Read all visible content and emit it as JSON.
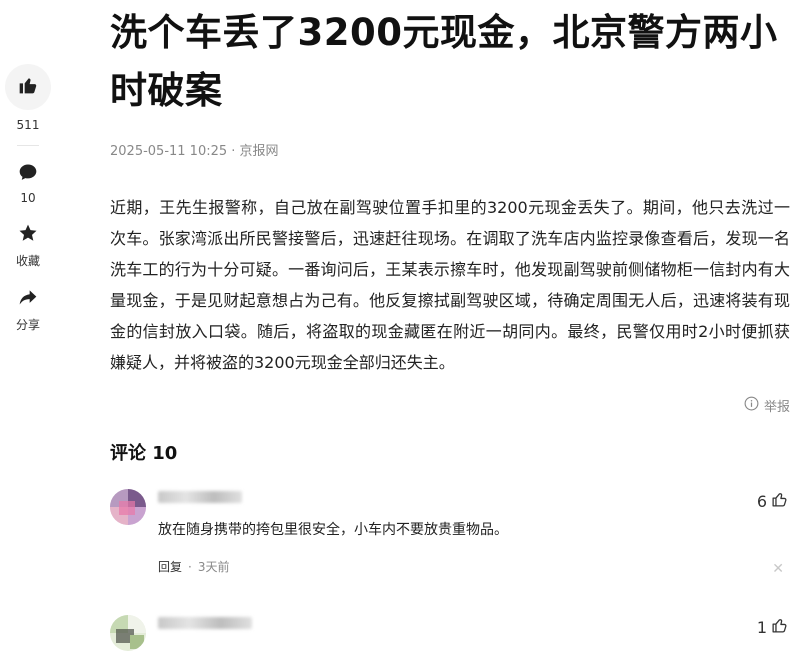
{
  "article": {
    "title": "洗个车丢了3200元现金，北京警方两小时破案",
    "meta": "2025-05-11 10:25 · 京报网",
    "body": "近期，王先生报警称，自己放在副驾驶位置手扣里的3200元现金丢失了。期间，他只去洗过一次车。张家湾派出所民警接警后，迅速赶往现场。在调取了洗车店内监控录像查看后，发现一名洗车工的行为十分可疑。一番询问后，王某表示擦车时，他发现副驾驶前侧储物柜一信封内有大量现金，于是见财起意想占为己有。他反复擦拭副驾驶区域，待确定周围无人后，迅速将装有现金的信封放入口袋。随后，将盗取的现金藏匿在附近一胡同内。最终，民警仅用时2小时便抓获嫌疑人，并将被盗的3200元现金全部归还失主。",
    "report_label": "举报"
  },
  "rail": {
    "like_count": "511",
    "comment_count": "10",
    "favorite_label": "收藏",
    "share_label": "分享"
  },
  "comments": {
    "header": "评论 10",
    "items": [
      {
        "text": "放在随身携带的挎包里很安全，小车内不要放贵重物品。",
        "likes": "6",
        "reply_label": "回复",
        "time": "3天前"
      },
      {
        "text": "",
        "likes": "1",
        "reply_label": "",
        "time": ""
      }
    ]
  },
  "icons": {
    "like": "thumbs-up-icon",
    "comment": "comment-bubble-icon",
    "favorite": "star-icon",
    "share": "share-arrow-icon",
    "report": "info-circle-icon",
    "close": "close-icon"
  }
}
